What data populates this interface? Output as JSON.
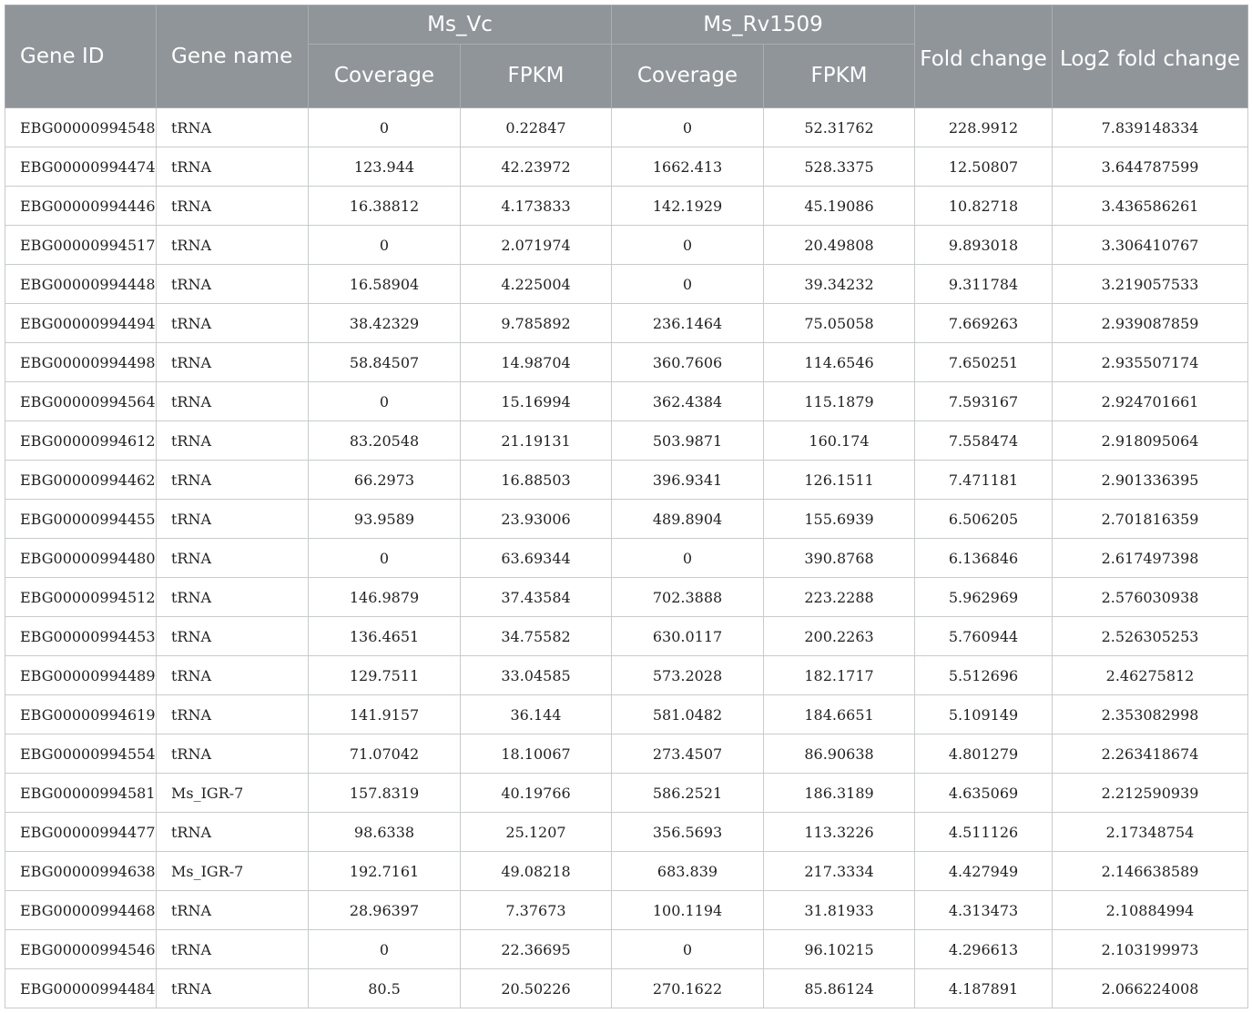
{
  "table": {
    "headers": {
      "gene_id": "Gene ID",
      "gene_name": "Gene name",
      "group1": "Ms_Vc",
      "group2": "Ms_Rv1509",
      "coverage": "Coverage",
      "fpkm": "FPKM",
      "fold_change": "Fold change",
      "log2_fold_change": "Log2 fold change"
    },
    "rows": [
      {
        "id": "EBG00000994548",
        "name": "tRNA",
        "vc_cov": "0",
        "vc_fpkm": "0.22847",
        "rv_cov": "0",
        "rv_fpkm": "52.31762",
        "fc": "228.9912",
        "log2fc": "7.839148334"
      },
      {
        "id": "EBG00000994474",
        "name": "tRNA",
        "vc_cov": "123.944",
        "vc_fpkm": "42.23972",
        "rv_cov": "1662.413",
        "rv_fpkm": "528.3375",
        "fc": "12.50807",
        "log2fc": "3.644787599"
      },
      {
        "id": "EBG00000994446",
        "name": "tRNA",
        "vc_cov": "16.38812",
        "vc_fpkm": "4.173833",
        "rv_cov": "142.1929",
        "rv_fpkm": "45.19086",
        "fc": "10.82718",
        "log2fc": "3.436586261"
      },
      {
        "id": "EBG00000994517",
        "name": "tRNA",
        "vc_cov": "0",
        "vc_fpkm": "2.071974",
        "rv_cov": "0",
        "rv_fpkm": "20.49808",
        "fc": "9.893018",
        "log2fc": "3.306410767"
      },
      {
        "id": "EBG00000994448",
        "name": "tRNA",
        "vc_cov": "16.58904",
        "vc_fpkm": "4.225004",
        "rv_cov": "0",
        "rv_fpkm": "39.34232",
        "fc": "9.311784",
        "log2fc": "3.219057533"
      },
      {
        "id": "EBG00000994494",
        "name": "tRNA",
        "vc_cov": "38.42329",
        "vc_fpkm": "9.785892",
        "rv_cov": "236.1464",
        "rv_fpkm": "75.05058",
        "fc": "7.669263",
        "log2fc": "2.939087859"
      },
      {
        "id": "EBG00000994498",
        "name": "tRNA",
        "vc_cov": "58.84507",
        "vc_fpkm": "14.98704",
        "rv_cov": "360.7606",
        "rv_fpkm": "114.6546",
        "fc": "7.650251",
        "log2fc": "2.935507174"
      },
      {
        "id": "EBG00000994564",
        "name": "tRNA",
        "vc_cov": "0",
        "vc_fpkm": "15.16994",
        "rv_cov": "362.4384",
        "rv_fpkm": "115.1879",
        "fc": "7.593167",
        "log2fc": "2.924701661"
      },
      {
        "id": "EBG00000994612",
        "name": "tRNA",
        "vc_cov": "83.20548",
        "vc_fpkm": "21.19131",
        "rv_cov": "503.9871",
        "rv_fpkm": "160.174",
        "fc": "7.558474",
        "log2fc": "2.918095064"
      },
      {
        "id": "EBG00000994462",
        "name": "tRNA",
        "vc_cov": "66.2973",
        "vc_fpkm": "16.88503",
        "rv_cov": "396.9341",
        "rv_fpkm": "126.1511",
        "fc": "7.471181",
        "log2fc": "2.901336395"
      },
      {
        "id": "EBG00000994455",
        "name": "tRNA",
        "vc_cov": "93.9589",
        "vc_fpkm": "23.93006",
        "rv_cov": "489.8904",
        "rv_fpkm": "155.6939",
        "fc": "6.506205",
        "log2fc": "2.701816359"
      },
      {
        "id": "EBG00000994480",
        "name": "tRNA",
        "vc_cov": "0",
        "vc_fpkm": "63.69344",
        "rv_cov": "0",
        "rv_fpkm": "390.8768",
        "fc": "6.136846",
        "log2fc": "2.617497398"
      },
      {
        "id": "EBG00000994512",
        "name": "tRNA",
        "vc_cov": "146.9879",
        "vc_fpkm": "37.43584",
        "rv_cov": "702.3888",
        "rv_fpkm": "223.2288",
        "fc": "5.962969",
        "log2fc": "2.576030938"
      },
      {
        "id": "EBG00000994453",
        "name": "tRNA",
        "vc_cov": "136.4651",
        "vc_fpkm": "34.75582",
        "rv_cov": "630.0117",
        "rv_fpkm": "200.2263",
        "fc": "5.760944",
        "log2fc": "2.526305253"
      },
      {
        "id": "EBG00000994489",
        "name": "tRNA",
        "vc_cov": "129.7511",
        "vc_fpkm": "33.04585",
        "rv_cov": "573.2028",
        "rv_fpkm": "182.1717",
        "fc": "5.512696",
        "log2fc": "2.46275812"
      },
      {
        "id": "EBG00000994619",
        "name": "tRNA",
        "vc_cov": "141.9157",
        "vc_fpkm": "36.144",
        "rv_cov": "581.0482",
        "rv_fpkm": "184.6651",
        "fc": "5.109149",
        "log2fc": "2.353082998"
      },
      {
        "id": "EBG00000994554",
        "name": "tRNA",
        "vc_cov": "71.07042",
        "vc_fpkm": "18.10067",
        "rv_cov": "273.4507",
        "rv_fpkm": "86.90638",
        "fc": "4.801279",
        "log2fc": "2.263418674"
      },
      {
        "id": "EBG00000994581",
        "name": "Ms_IGR-7",
        "vc_cov": "157.8319",
        "vc_fpkm": "40.19766",
        "rv_cov": "586.2521",
        "rv_fpkm": "186.3189",
        "fc": "4.635069",
        "log2fc": "2.212590939"
      },
      {
        "id": "EBG00000994477",
        "name": "tRNA",
        "vc_cov": "98.6338",
        "vc_fpkm": "25.1207",
        "rv_cov": "356.5693",
        "rv_fpkm": "113.3226",
        "fc": "4.511126",
        "log2fc": "2.17348754"
      },
      {
        "id": "EBG00000994638",
        "name": "Ms_IGR-7",
        "vc_cov": "192.7161",
        "vc_fpkm": "49.08218",
        "rv_cov": "683.839",
        "rv_fpkm": "217.3334",
        "fc": "4.427949",
        "log2fc": "2.146638589"
      },
      {
        "id": "EBG00000994468",
        "name": "tRNA",
        "vc_cov": "28.96397",
        "vc_fpkm": "7.37673",
        "rv_cov": "100.1194",
        "rv_fpkm": "31.81933",
        "fc": "4.313473",
        "log2fc": "2.10884994"
      },
      {
        "id": "EBG00000994546",
        "name": "tRNA",
        "vc_cov": "0",
        "vc_fpkm": "22.36695",
        "rv_cov": "0",
        "rv_fpkm": "96.10215",
        "fc": "4.296613",
        "log2fc": "2.103199973"
      },
      {
        "id": "EBG00000994484",
        "name": "tRNA",
        "vc_cov": "80.5",
        "vc_fpkm": "20.50226",
        "rv_cov": "270.1622",
        "rv_fpkm": "85.86124",
        "fc": "4.187891",
        "log2fc": "2.066224008"
      }
    ]
  }
}
